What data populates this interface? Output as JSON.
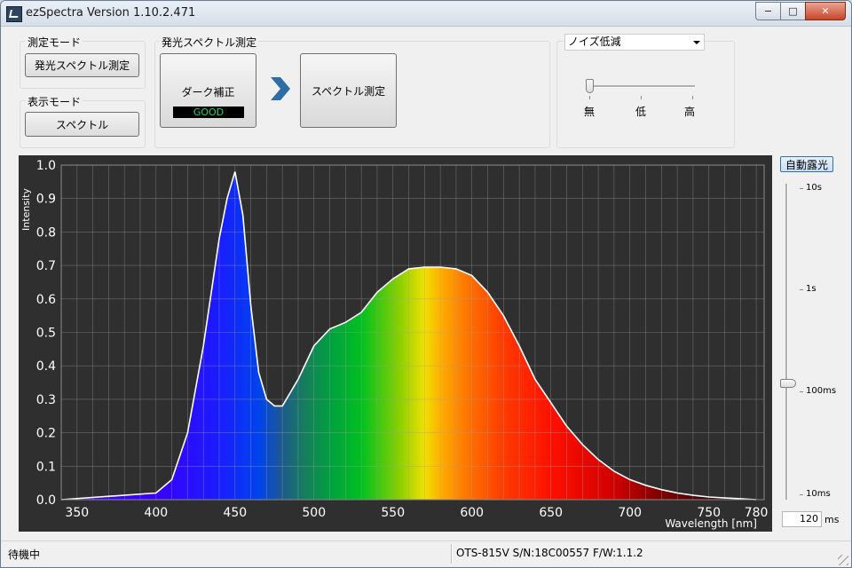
{
  "window": {
    "title": "ezSpectra Version 1.10.2.471",
    "btn_min": "−",
    "btn_max": "□",
    "btn_close": "✕"
  },
  "measure_mode": {
    "label": "測定モード",
    "button": "発光スペクトル測定"
  },
  "display_mode": {
    "label": "表示モード",
    "button": "スペクトル"
  },
  "emission_panel": {
    "label": "発光スペクトル測定",
    "dark_button": "ダーク補正",
    "dark_status": "GOOD",
    "measure_button": "スペクトル測定"
  },
  "noise": {
    "select_value": "ノイズ低減",
    "labels": [
      "無",
      "低",
      "高"
    ],
    "level": 0
  },
  "exposure": {
    "auto_button": "自動露光",
    "scale_labels": [
      "10s",
      "1s",
      "100ms",
      "10ms"
    ],
    "value": "120",
    "unit": "ms"
  },
  "status": {
    "left": "待機中",
    "right": "OTS-815V  S/N:18C00557  F/W:1.1.2"
  },
  "colors": {
    "plot_bg": "#2f2f2f",
    "curve": "#ffffff",
    "good_text": "#29d17a",
    "arrow": "#2e6ea6"
  },
  "chart_data": {
    "type": "area",
    "title": "",
    "xlabel": "Wavelength [nm]",
    "ylabel": "Intensity",
    "xlim": [
      340,
      785
    ],
    "ylim": [
      0,
      1.0
    ],
    "x_ticks": [
      350,
      400,
      450,
      500,
      550,
      600,
      650,
      700,
      750,
      780
    ],
    "y_ticks": [
      0.0,
      0.1,
      0.2,
      0.3,
      0.4,
      0.5,
      0.6,
      0.7,
      0.8,
      0.9,
      1.0
    ],
    "y_tick_labels": [
      "0.0",
      "0.1",
      "0.2",
      "0.3",
      "0.4",
      "0.5",
      "0.6",
      "0.7",
      "0.8",
      "0.9",
      "1.0"
    ],
    "grid": true,
    "fill": "visible-spectrum-colors",
    "x": [
      340,
      400,
      410,
      420,
      430,
      440,
      445,
      450,
      455,
      460,
      465,
      470,
      475,
      480,
      490,
      500,
      510,
      520,
      530,
      540,
      550,
      560,
      570,
      580,
      590,
      600,
      610,
      620,
      630,
      640,
      650,
      660,
      670,
      680,
      690,
      700,
      710,
      720,
      730,
      740,
      750,
      760,
      770,
      780
    ],
    "y": [
      0.0,
      0.02,
      0.06,
      0.2,
      0.46,
      0.78,
      0.9,
      0.98,
      0.85,
      0.58,
      0.38,
      0.3,
      0.28,
      0.28,
      0.36,
      0.46,
      0.51,
      0.53,
      0.56,
      0.62,
      0.66,
      0.69,
      0.695,
      0.695,
      0.69,
      0.67,
      0.62,
      0.55,
      0.46,
      0.36,
      0.29,
      0.22,
      0.165,
      0.12,
      0.085,
      0.06,
      0.043,
      0.03,
      0.02,
      0.013,
      0.008,
      0.005,
      0.003,
      0.0
    ]
  }
}
